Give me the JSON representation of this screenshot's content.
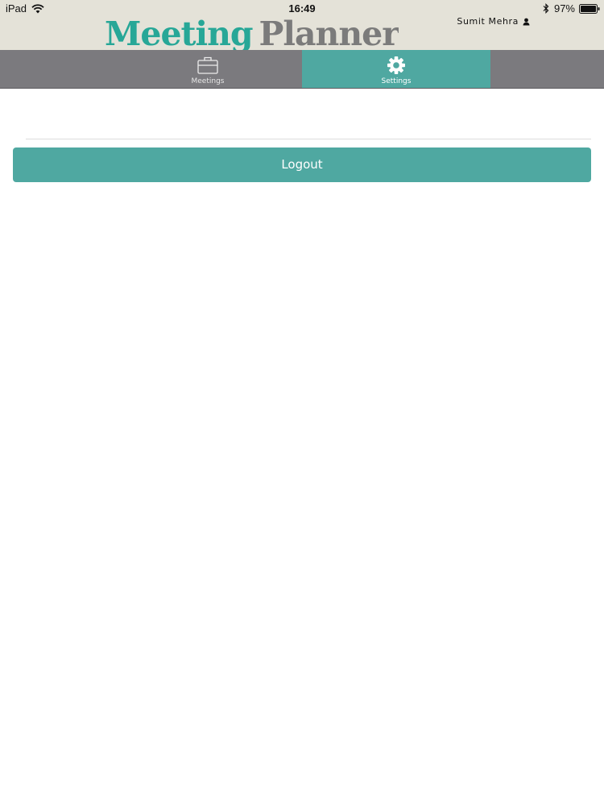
{
  "status_bar": {
    "device": "iPad",
    "time": "16:49",
    "battery": "97%",
    "icons": [
      "wifi-icon",
      "bluetooth-icon",
      "battery-icon"
    ]
  },
  "header": {
    "brand_word1": "Meeting",
    "brand_word2": "Planner",
    "user_name": "Sumit Mehra",
    "user_icon": "user-icon"
  },
  "tabs": [
    {
      "label": "Meetings",
      "icon": "briefcase-icon",
      "active": false
    },
    {
      "label": "Settings",
      "icon": "gear-icon",
      "active": true
    }
  ],
  "main": {
    "logout_label": "Logout"
  },
  "colors": {
    "accent": "#4fa8a1",
    "brand_teal": "#27a797",
    "brand_grey": "#7b7b7b",
    "tabbar": "#7b7a7e",
    "header_bg": "#e4e2d8"
  }
}
